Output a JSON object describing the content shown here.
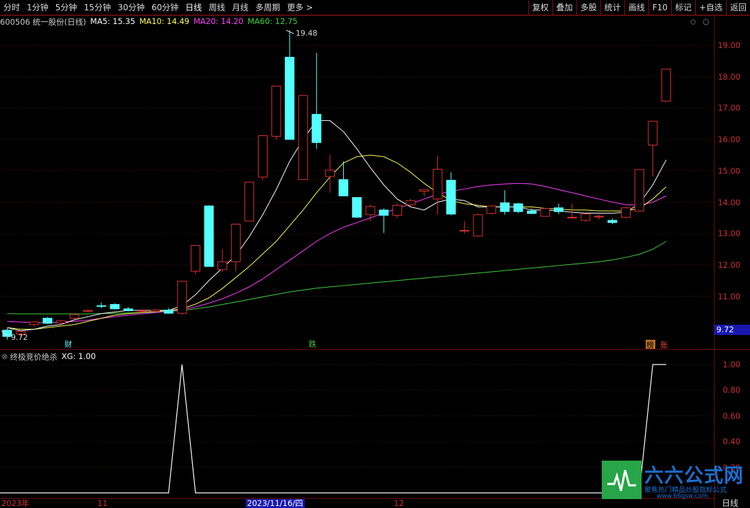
{
  "toolbar": {
    "periods": [
      "分时",
      "1分钟",
      "5分钟",
      "15分钟",
      "30分钟",
      "60分钟",
      "日线",
      "周线",
      "月线",
      "多周期",
      "更多 >"
    ],
    "active_period": "日线",
    "buttons": [
      "复权",
      "叠加",
      "多股",
      "统计",
      "画线",
      "F10",
      "标记",
      "+自选",
      "返回"
    ]
  },
  "info": {
    "stock": "600506 统一股份(日线)",
    "ma5": "MA5: 15.35",
    "ma10": "MA10: 14.49",
    "ma20": "MA20: 14.20",
    "ma60": "MA60: 12.75"
  },
  "colors": {
    "up": "#e03030",
    "down": "#54ffff",
    "ma5": "#ffffff",
    "ma10": "#ffff50",
    "ma20": "#ff40ff",
    "ma60": "#40d040",
    "border": "#7a1010",
    "grid": "#5a1010"
  },
  "indicator": {
    "name": "终极竞价绝杀",
    "value": "XG: 1.00"
  },
  "price_axis": [
    "19.00",
    "18.00",
    "17.00",
    "16.00",
    "15.00",
    "14.00",
    "13.00",
    "12.00",
    "11.00"
  ],
  "current_price_tag": "9.72",
  "ind_axis": [
    "1.00",
    "0.80",
    "0.60",
    "0.40",
    "0.20"
  ],
  "annotations": {
    "high": "19.48",
    "low": "9.72",
    "cai": "财",
    "die": "跌",
    "bang": "榜",
    "zhang": "张"
  },
  "dates": [
    "2023年",
    "11",
    "2023/11/16/四",
    "12"
  ],
  "status": "日线",
  "logo": {
    "title": "六六公式网",
    "subtitle": "聚焦热门精品炒股指标公式",
    "url": "www.66gsw.com"
  },
  "chart_data": {
    "type": "candlestick",
    "ylim": [
      9.6,
      19.6
    ],
    "candles": [
      {
        "o": 9.92,
        "h": 9.98,
        "l": 9.62,
        "c": 9.72
      },
      {
        "o": 9.8,
        "h": 9.9,
        "l": 9.72,
        "c": 9.88
      },
      {
        "o": 10.1,
        "h": 10.2,
        "l": 10.04,
        "c": 10.18
      },
      {
        "o": 10.3,
        "h": 10.34,
        "l": 10.12,
        "c": 10.14
      },
      {
        "o": 10.15,
        "h": 10.24,
        "l": 10.1,
        "c": 10.22
      },
      {
        "o": 10.3,
        "h": 10.46,
        "l": 10.26,
        "c": 10.42
      },
      {
        "o": 10.52,
        "h": 10.58,
        "l": 10.48,
        "c": 10.55
      },
      {
        "o": 10.7,
        "h": 10.8,
        "l": 10.62,
        "c": 10.68
      },
      {
        "o": 10.74,
        "h": 10.78,
        "l": 10.58,
        "c": 10.6
      },
      {
        "o": 10.6,
        "h": 10.66,
        "l": 10.52,
        "c": 10.54
      },
      {
        "o": 10.52,
        "h": 10.58,
        "l": 10.48,
        "c": 10.54
      },
      {
        "o": 10.52,
        "h": 10.6,
        "l": 10.46,
        "c": 10.56
      },
      {
        "o": 10.56,
        "h": 10.62,
        "l": 10.44,
        "c": 10.46
      },
      {
        "o": 10.46,
        "h": 11.48,
        "l": 10.42,
        "c": 11.48
      },
      {
        "o": 11.8,
        "h": 12.62,
        "l": 11.7,
        "c": 12.62
      },
      {
        "o": 13.88,
        "h": 13.9,
        "l": 11.95,
        "c": 11.95
      },
      {
        "o": 11.85,
        "h": 12.5,
        "l": 11.78,
        "c": 12.1
      },
      {
        "o": 12.1,
        "h": 13.3,
        "l": 11.8,
        "c": 13.3
      },
      {
        "o": 13.4,
        "h": 14.64,
        "l": 13.4,
        "c": 14.64
      },
      {
        "o": 14.8,
        "h": 16.12,
        "l": 14.7,
        "c": 16.12
      },
      {
        "o": 16.1,
        "h": 17.7,
        "l": 16.0,
        "c": 17.7
      },
      {
        "o": 18.62,
        "h": 19.48,
        "l": 16.0,
        "c": 16.0
      },
      {
        "o": 14.72,
        "h": 17.4,
        "l": 14.72,
        "c": 17.4
      },
      {
        "o": 16.8,
        "h": 18.76,
        "l": 15.7,
        "c": 15.9
      },
      {
        "o": 14.82,
        "h": 15.52,
        "l": 14.3,
        "c": 15.02
      },
      {
        "o": 14.72,
        "h": 15.3,
        "l": 14.24,
        "c": 14.2
      },
      {
        "o": 14.15,
        "h": 14.15,
        "l": 13.5,
        "c": 13.52
      },
      {
        "o": 13.6,
        "h": 13.92,
        "l": 13.4,
        "c": 13.86
      },
      {
        "o": 13.75,
        "h": 13.8,
        "l": 13.02,
        "c": 13.58
      },
      {
        "o": 13.58,
        "h": 13.96,
        "l": 13.5,
        "c": 13.9
      },
      {
        "o": 13.92,
        "h": 14.1,
        "l": 13.86,
        "c": 14.05
      },
      {
        "o": 14.35,
        "h": 14.4,
        "l": 14.2,
        "c": 14.4
      },
      {
        "o": 14.1,
        "h": 15.48,
        "l": 13.6,
        "c": 15.05
      },
      {
        "o": 14.7,
        "h": 14.95,
        "l": 13.58,
        "c": 13.62
      },
      {
        "o": 13.1,
        "h": 13.4,
        "l": 13.0,
        "c": 13.1
      },
      {
        "o": 12.92,
        "h": 13.64,
        "l": 12.9,
        "c": 13.6
      },
      {
        "o": 13.64,
        "h": 13.9,
        "l": 13.6,
        "c": 13.88
      },
      {
        "o": 13.98,
        "h": 14.38,
        "l": 13.6,
        "c": 13.7
      },
      {
        "o": 13.95,
        "h": 13.98,
        "l": 13.65,
        "c": 13.7
      },
      {
        "o": 13.72,
        "h": 13.8,
        "l": 13.62,
        "c": 13.64
      },
      {
        "o": 13.55,
        "h": 13.8,
        "l": 13.55,
        "c": 13.8
      },
      {
        "o": 13.82,
        "h": 13.96,
        "l": 13.62,
        "c": 13.7
      },
      {
        "o": 13.52,
        "h": 13.95,
        "l": 13.5,
        "c": 13.52
      },
      {
        "o": 13.42,
        "h": 13.62,
        "l": 13.38,
        "c": 13.62
      },
      {
        "o": 13.55,
        "h": 13.6,
        "l": 13.45,
        "c": 13.55
      },
      {
        "o": 13.42,
        "h": 13.48,
        "l": 13.3,
        "c": 13.35
      },
      {
        "o": 13.52,
        "h": 13.85,
        "l": 13.48,
        "c": 13.82
      },
      {
        "o": 13.72,
        "h": 15.04,
        "l": 13.7,
        "c": 15.04
      },
      {
        "o": 15.82,
        "h": 16.58,
        "l": 14.82,
        "c": 16.58
      },
      {
        "o": 17.22,
        "h": 18.24,
        "l": 17.22,
        "c": 18.24
      }
    ],
    "ma5": [
      10.0,
      9.9,
      9.95,
      10.05,
      10.1,
      10.25,
      10.35,
      10.45,
      10.5,
      10.55,
      10.55,
      10.55,
      10.55,
      10.7,
      11.05,
      11.5,
      11.9,
      12.3,
      12.9,
      13.6,
      14.4,
      15.3,
      16.0,
      16.6,
      16.6,
      16.25,
      15.7,
      15.1,
      14.55,
      14.1,
      13.85,
      13.75,
      14.0,
      14.1,
      14.05,
      13.85,
      13.85,
      13.85,
      13.85,
      13.75,
      13.75,
      13.72,
      13.68,
      13.65,
      13.65,
      13.65,
      13.68,
      13.95,
      14.55,
      15.35
    ],
    "ma10": [
      10.0,
      9.95,
      9.95,
      10.0,
      10.05,
      10.1,
      10.2,
      10.3,
      10.4,
      10.45,
      10.48,
      10.52,
      10.55,
      10.6,
      10.75,
      10.95,
      11.25,
      11.6,
      11.95,
      12.35,
      12.75,
      13.25,
      13.75,
      14.3,
      14.8,
      15.25,
      15.45,
      15.5,
      15.45,
      15.25,
      14.95,
      14.6,
      14.3,
      14.05,
      13.95,
      13.9,
      13.85,
      13.85,
      13.85,
      13.85,
      13.8,
      13.78,
      13.75,
      13.75,
      13.72,
      13.72,
      13.72,
      13.8,
      14.1,
      14.49
    ],
    "ma20": [
      10.2,
      10.18,
      10.16,
      10.16,
      10.18,
      10.2,
      10.24,
      10.3,
      10.35,
      10.4,
      10.44,
      10.48,
      10.52,
      10.58,
      10.66,
      10.78,
      10.92,
      11.1,
      11.3,
      11.55,
      11.85,
      12.15,
      12.45,
      12.75,
      13.0,
      13.2,
      13.35,
      13.5,
      13.65,
      13.8,
      13.95,
      14.1,
      14.25,
      14.35,
      14.42,
      14.5,
      14.55,
      14.58,
      14.6,
      14.58,
      14.5,
      14.4,
      14.3,
      14.2,
      14.1,
      14.0,
      13.92,
      13.9,
      14.0,
      14.2
    ],
    "ma60": [
      10.45,
      10.44,
      10.44,
      10.44,
      10.44,
      10.44,
      10.44,
      10.45,
      10.46,
      10.47,
      10.48,
      10.5,
      10.52,
      10.55,
      10.6,
      10.66,
      10.74,
      10.82,
      10.9,
      10.98,
      11.06,
      11.14,
      11.2,
      11.26,
      11.3,
      11.34,
      11.38,
      11.42,
      11.46,
      11.5,
      11.54,
      11.58,
      11.62,
      11.66,
      11.7,
      11.74,
      11.78,
      11.82,
      11.86,
      11.9,
      11.94,
      11.98,
      12.02,
      12.06,
      12.1,
      12.16,
      12.24,
      12.34,
      12.5,
      12.75
    ],
    "xg": [
      0,
      0,
      0,
      0,
      0,
      0,
      0,
      0,
      0,
      0,
      0,
      0,
      0,
      1,
      0,
      0,
      0,
      0,
      0,
      0,
      0,
      0,
      0,
      0,
      0,
      0,
      0,
      0,
      0,
      0,
      0,
      0,
      0,
      0,
      0,
      0,
      0,
      0,
      0,
      0,
      0,
      0,
      0,
      0,
      0,
      0,
      0,
      0,
      1,
      1
    ]
  }
}
